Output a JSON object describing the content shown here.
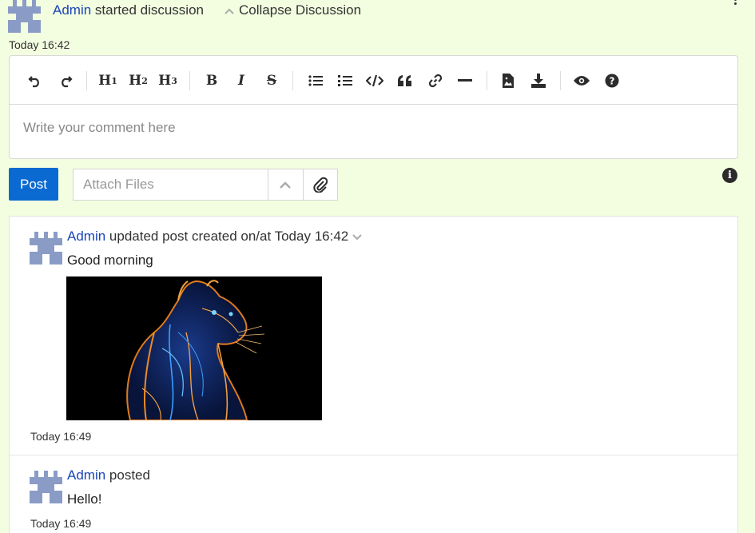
{
  "discussion": {
    "author": "Admin",
    "action": "started discussion",
    "collapse_label": "Collapse Discussion",
    "time": "Today 16:42"
  },
  "editor": {
    "placeholder": "Write your comment here",
    "toolbar": [
      "undo-icon",
      "redo-icon",
      "heading-1-icon",
      "heading-2-icon",
      "heading-3-icon",
      "bold-icon",
      "italic-icon",
      "strikethrough-icon",
      "bullet-list-icon",
      "numbered-list-icon",
      "code-icon",
      "quote-icon",
      "link-icon",
      "horizontal-rule-icon",
      "upload-image-icon",
      "download-icon",
      "preview-eye-icon",
      "help-icon"
    ]
  },
  "post_row": {
    "post_label": "Post",
    "attach_placeholder": "Attach Files"
  },
  "feed": [
    {
      "author": "Admin",
      "action": "updated post created on/at Today 16:42",
      "body": "Good morning",
      "time": "Today 16:49",
      "has_image": true
    },
    {
      "author": "Admin",
      "action": "posted",
      "body": "Hello!",
      "time": "Today 16:49"
    }
  ],
  "colors": {
    "background": "#f3fde0",
    "link": "#1a45b8",
    "post_button": "#0a6ad1",
    "avatar": "#8a9cc6"
  }
}
